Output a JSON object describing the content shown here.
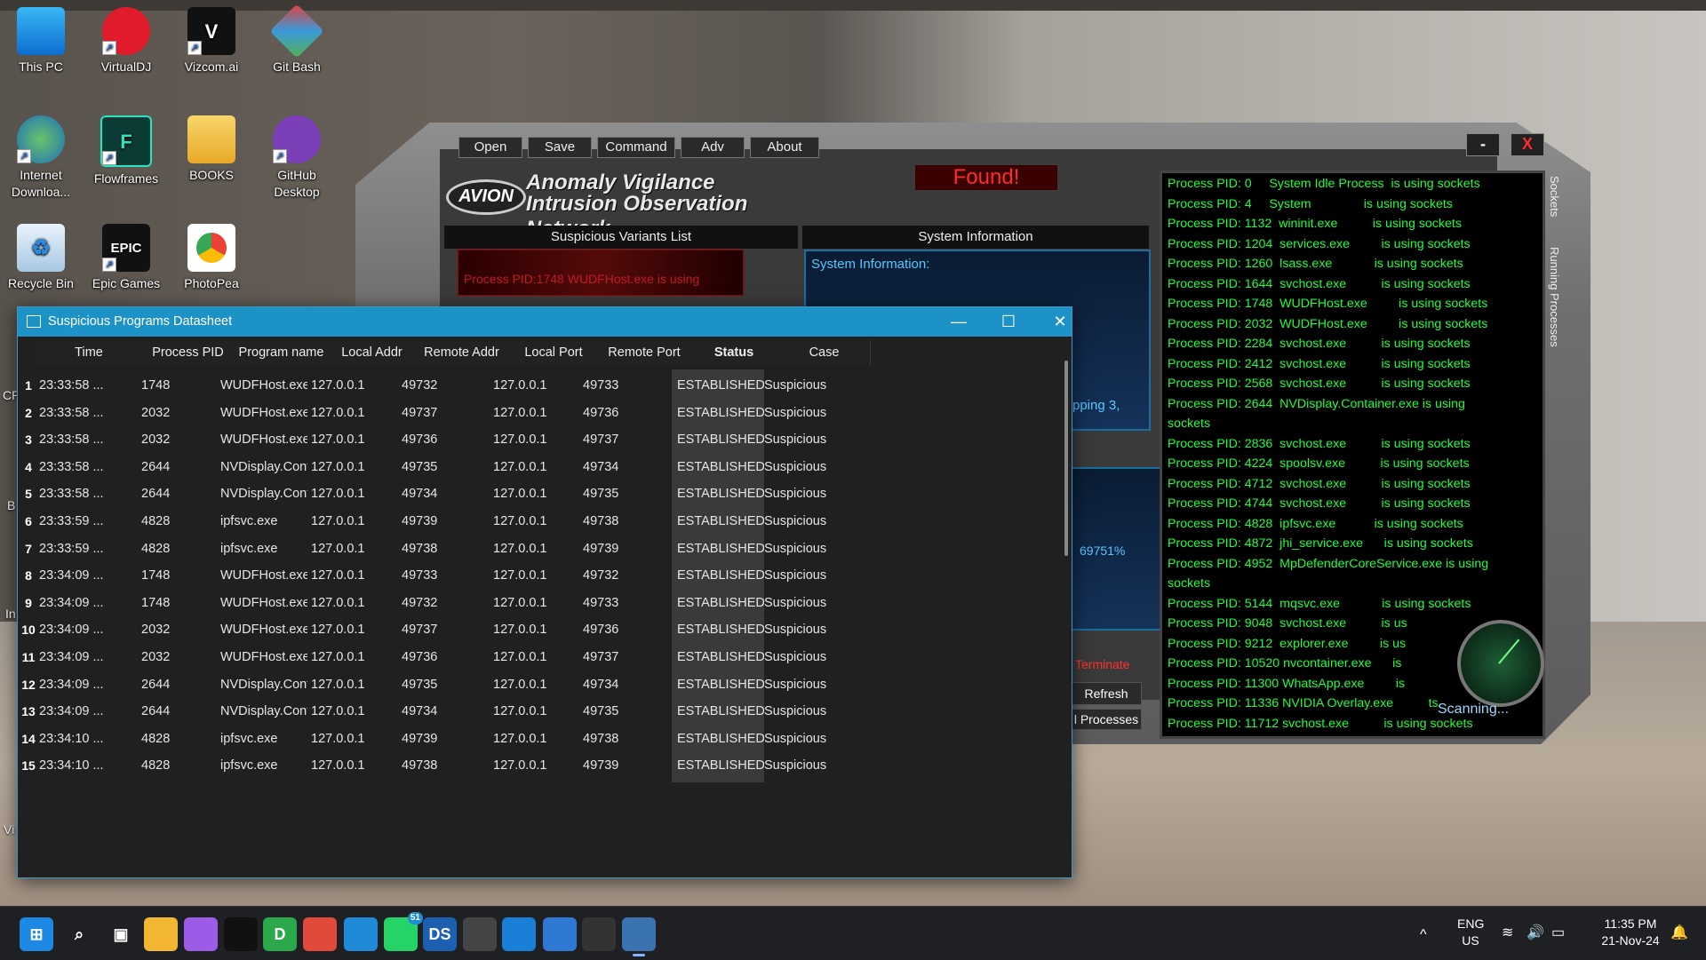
{
  "desktop": {
    "icons": [
      {
        "label": "This PC"
      },
      {
        "label": "VirtualDJ"
      },
      {
        "label": "Vizcom.ai"
      },
      {
        "label": "Git Bash"
      },
      {
        "label": "Internet Downloa..."
      },
      {
        "label": "Flowframes"
      },
      {
        "label": "BOOKS"
      },
      {
        "label": "GitHub Desktop"
      },
      {
        "label": "Recycle Bin"
      },
      {
        "label": "Epic Games"
      },
      {
        "label": "PhotoPea"
      }
    ],
    "partial_labels": {
      "cp": "CP",
      "b": "B",
      "in": "In",
      "vi": "Vi"
    }
  },
  "avion": {
    "menu": [
      "Open",
      "Save",
      "Command",
      "Adv",
      "About"
    ],
    "badge": "AVION",
    "title_line1": "Anomaly Vigilance",
    "title_line2": "Intrusion Observation Network",
    "found": "Found!",
    "minimize": "-",
    "close": "X",
    "panel_suspicious": "Suspicious Variants List",
    "panel_sysinfo": "System Information",
    "suspicious_row": "Process PID:1748  WUDFHost.exe        is using",
    "sysinfo_label": "System Information:",
    "sysinfo_partial": "pping 3,",
    "sysinfo2_partial": "69751%",
    "terminate": "Terminate",
    "refresh": "Refresh",
    "processes": "l Processes",
    "tab_sockets": "Sockets",
    "tab_running": "Running Processes",
    "scanning": "Scanning...",
    "processes_list": [
      "Process PID: 0     System Idle Process  is using sockets",
      "Process PID: 4     System               is using sockets",
      "Process PID: 1132  wininit.exe          is using sockets",
      "Process PID: 1204  services.exe         is using sockets",
      "Process PID: 1260  lsass.exe            is using sockets",
      "Process PID: 1644  svchost.exe          is using sockets",
      "Process PID: 1748  WUDFHost.exe         is using sockets",
      "Process PID: 2032  WUDFHost.exe         is using sockets",
      "Process PID: 2284  svchost.exe          is using sockets",
      "Process PID: 2412  svchost.exe          is using sockets",
      "Process PID: 2568  svchost.exe          is using sockets",
      "Process PID: 2644  NVDisplay.Container.exe is using",
      "sockets",
      "Process PID: 2836  svchost.exe          is using sockets",
      "Process PID: 4224  spoolsv.exe          is using sockets",
      "Process PID: 4712  svchost.exe          is using sockets",
      "Process PID: 4744  svchost.exe          is using sockets",
      "Process PID: 4828  ipfsvc.exe           is using sockets",
      "Process PID: 4872  jhi_service.exe      is using sockets",
      "Process PID: 4952  MpDefenderCoreService.exe is using",
      "sockets",
      "Process PID: 5144  mqsvc.exe            is using sockets",
      "Process PID: 9048  svchost.exe          is us",
      "Process PID: 9212  explorer.exe         is us",
      "Process PID: 10520 nvcontainer.exe      is",
      "Process PID: 11300 WhatsApp.exe         is",
      "Process PID: 11336 NVIDIA Overlay.exe          ts",
      "Process PID: 11712 svchost.exe          is using sockets"
    ]
  },
  "datasheet": {
    "title": "Suspicious Programs Datasheet",
    "minimize": "—",
    "maximize": "☐",
    "close": "✕",
    "columns": [
      "Time",
      "Process PID",
      "Program name",
      "Local Addr",
      "Remote Addr",
      "Local Port",
      "Remote Port",
      "Status",
      "Case"
    ],
    "rows": [
      {
        "n": "1",
        "time": "23:33:58 ...",
        "pid": "1748",
        "prog": "WUDFHost.exe",
        "laddr": "127.0.0.1",
        "raddr": "49732",
        "lport": "127.0.0.1",
        "rport": "49733",
        "status": "ESTABLISHED",
        "case": "Suspicious"
      },
      {
        "n": "2",
        "time": "23:33:58 ...",
        "pid": "2032",
        "prog": "WUDFHost.exe",
        "laddr": "127.0.0.1",
        "raddr": "49737",
        "lport": "127.0.0.1",
        "rport": "49736",
        "status": "ESTABLISHED",
        "case": "Suspicious"
      },
      {
        "n": "3",
        "time": "23:33:58 ...",
        "pid": "2032",
        "prog": "WUDFHost.exe",
        "laddr": "127.0.0.1",
        "raddr": "49736",
        "lport": "127.0.0.1",
        "rport": "49737",
        "status": "ESTABLISHED",
        "case": "Suspicious"
      },
      {
        "n": "4",
        "time": "23:33:58 ...",
        "pid": "2644",
        "prog": "NVDisplay.Cont...",
        "laddr": "127.0.0.1",
        "raddr": "49735",
        "lport": "127.0.0.1",
        "rport": "49734",
        "status": "ESTABLISHED",
        "case": "Suspicious"
      },
      {
        "n": "5",
        "time": "23:33:58 ...",
        "pid": "2644",
        "prog": "NVDisplay.Cont...",
        "laddr": "127.0.0.1",
        "raddr": "49734",
        "lport": "127.0.0.1",
        "rport": "49735",
        "status": "ESTABLISHED",
        "case": "Suspicious"
      },
      {
        "n": "6",
        "time": "23:33:59 ...",
        "pid": "4828",
        "prog": "ipfsvc.exe",
        "laddr": "127.0.0.1",
        "raddr": "49739",
        "lport": "127.0.0.1",
        "rport": "49738",
        "status": "ESTABLISHED",
        "case": "Suspicious"
      },
      {
        "n": "7",
        "time": "23:33:59 ...",
        "pid": "4828",
        "prog": "ipfsvc.exe",
        "laddr": "127.0.0.1",
        "raddr": "49738",
        "lport": "127.0.0.1",
        "rport": "49739",
        "status": "ESTABLISHED",
        "case": "Suspicious"
      },
      {
        "n": "8",
        "time": "23:34:09 ...",
        "pid": "1748",
        "prog": "WUDFHost.exe",
        "laddr": "127.0.0.1",
        "raddr": "49733",
        "lport": "127.0.0.1",
        "rport": "49732",
        "status": "ESTABLISHED",
        "case": "Suspicious"
      },
      {
        "n": "9",
        "time": "23:34:09 ...",
        "pid": "1748",
        "prog": "WUDFHost.exe",
        "laddr": "127.0.0.1",
        "raddr": "49732",
        "lport": "127.0.0.1",
        "rport": "49733",
        "status": "ESTABLISHED",
        "case": "Suspicious"
      },
      {
        "n": "10",
        "time": "23:34:09 ...",
        "pid": "2032",
        "prog": "WUDFHost.exe",
        "laddr": "127.0.0.1",
        "raddr": "49737",
        "lport": "127.0.0.1",
        "rport": "49736",
        "status": "ESTABLISHED",
        "case": "Suspicious"
      },
      {
        "n": "11",
        "time": "23:34:09 ...",
        "pid": "2032",
        "prog": "WUDFHost.exe",
        "laddr": "127.0.0.1",
        "raddr": "49736",
        "lport": "127.0.0.1",
        "rport": "49737",
        "status": "ESTABLISHED",
        "case": "Suspicious"
      },
      {
        "n": "12",
        "time": "23:34:09 ...",
        "pid": "2644",
        "prog": "NVDisplay.Cont...",
        "laddr": "127.0.0.1",
        "raddr": "49735",
        "lport": "127.0.0.1",
        "rport": "49734",
        "status": "ESTABLISHED",
        "case": "Suspicious"
      },
      {
        "n": "13",
        "time": "23:34:09 ...",
        "pid": "2644",
        "prog": "NVDisplay.Cont...",
        "laddr": "127.0.0.1",
        "raddr": "49734",
        "lport": "127.0.0.1",
        "rport": "49735",
        "status": "ESTABLISHED",
        "case": "Suspicious"
      },
      {
        "n": "14",
        "time": "23:34:10 ...",
        "pid": "4828",
        "prog": "ipfsvc.exe",
        "laddr": "127.0.0.1",
        "raddr": "49739",
        "lport": "127.0.0.1",
        "rport": "49738",
        "status": "ESTABLISHED",
        "case": "Suspicious"
      },
      {
        "n": "15",
        "time": "23:34:10 ...",
        "pid": "4828",
        "prog": "ipfsvc.exe",
        "laddr": "127.0.0.1",
        "raddr": "49738",
        "lport": "127.0.0.1",
        "rport": "49739",
        "status": "ESTABLISHED",
        "case": "Suspicious"
      }
    ]
  },
  "taskbar": {
    "apps": [
      "start-icon",
      "search-icon",
      "task-view-icon",
      "file-explorer-icon",
      "copilot-icon",
      "vizcom-icon",
      "d-app-icon",
      "chrome-icon",
      "edge-icon",
      "whatsapp-icon",
      "ds-app-icon",
      "chatgpt-icon",
      "vscode-icon",
      "notepad-icon",
      "terminal-icon",
      "python-icon"
    ],
    "whatsapp_badge": "51",
    "d_label": "D",
    "ds_label": "DS",
    "lang_top": "ENG",
    "lang_bottom": "US",
    "time": "11:35 PM",
    "date": "21-Nov-24",
    "chevron": "^"
  }
}
